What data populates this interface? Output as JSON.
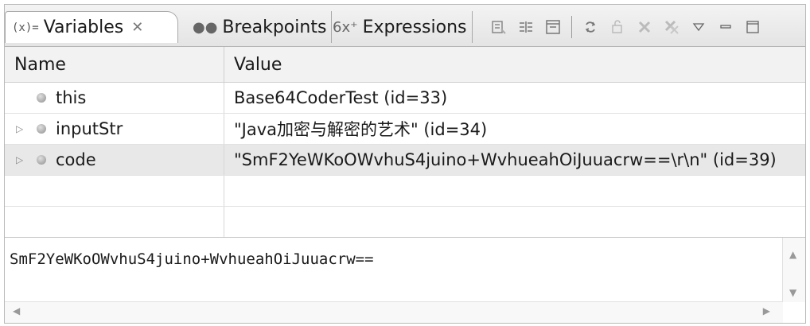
{
  "tabs": {
    "variables": {
      "icon": "(x)=",
      "label": "Variables",
      "close": "✕"
    },
    "breakpoints": {
      "icon": "●●",
      "label": "Breakpoints"
    },
    "expressions": {
      "icon": "6x⁺",
      "label": "Expressions"
    }
  },
  "toolbar_icons": [
    "show-type-names-icon",
    "show-logical-structure-icon",
    "collapse-all-icon",
    "link-icon",
    "add-watch-icon",
    "remove-icon",
    "remove-all-icon",
    "view-menu-icon",
    "minimize-icon",
    "maximize-icon"
  ],
  "table": {
    "headers": {
      "name": "Name",
      "value": "Value"
    },
    "rows": [
      {
        "name": "this",
        "value": "Base64CoderTest  (id=33)"
      },
      {
        "name": "inputStr",
        "value": "\"Java加密与解密的艺术\" (id=34)"
      },
      {
        "name": "code",
        "value": "\"SmF2YeWKoOWvhuS4juino+WvhueahOiJuuacrw==\\r\\n\" (id=39)"
      }
    ]
  },
  "detail": {
    "text": "SmF2YeWKoOWvhuS4juino+WvhueahOiJuuacrw=="
  }
}
